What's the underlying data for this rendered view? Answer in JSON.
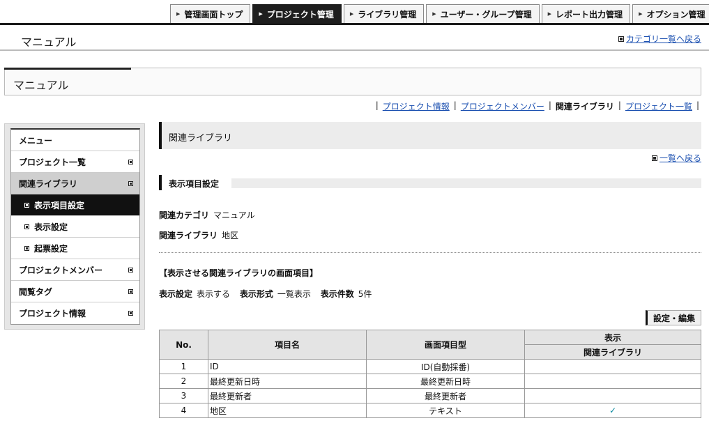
{
  "top_nav": {
    "tabs": [
      {
        "label": "管理画面トップ"
      },
      {
        "label": "プロジェクト管理",
        "active": true
      },
      {
        "label": "ライブラリ管理"
      },
      {
        "label": "ユーザー・グループ管理"
      },
      {
        "label": "レポート出力管理"
      },
      {
        "label": "オプション管理"
      }
    ]
  },
  "header": {
    "title": "マニュアル",
    "back_to_category": "カテゴリ一覧へ戻る"
  },
  "section": {
    "title": "マニュアル"
  },
  "sub_links": {
    "project_info": "プロジェクト情報",
    "project_members": "プロジェクトメンバー",
    "related_library": "関連ライブラリ",
    "project_list": "プロジェクト一覧"
  },
  "sidebar": {
    "menu_title": "メニュー",
    "items": {
      "project_list": "プロジェクト一覧",
      "related_library": "関連ライブラリ",
      "display_item_settings": "表示項目設定",
      "display_settings": "表示設定",
      "ticket_settings": "起票設定",
      "project_members": "プロジェクトメンバー",
      "view_tags": "閲覧タグ",
      "project_info": "プロジェクト情報"
    }
  },
  "main": {
    "title": "関連ライブラリ",
    "back_to_list": "一覧へ戻る",
    "subhead": "表示項目設定",
    "related_category_label": "関連カテゴリ",
    "related_category_value": "マニュアル",
    "related_library_label": "関連ライブラリ",
    "related_library_value": "地区",
    "screen_items_heading": "【表示させる関連ライブラリの画面項目】",
    "display_setting_label": "表示設定",
    "display_setting_value": "表示する",
    "display_format_label": "表示形式",
    "display_format_value": "一覧表示",
    "display_count_label": "表示件数",
    "display_count_value": "5件",
    "edit_button": "設定・編集"
  },
  "table": {
    "headers": {
      "no": "No.",
      "item_name": "項目名",
      "screen_type": "画面項目型",
      "display": "表示",
      "related_library": "関連ライブラリ"
    },
    "rows": [
      {
        "no": "1",
        "name": "ID",
        "type": "ID(自動採番)",
        "check": ""
      },
      {
        "no": "2",
        "name": "最終更新日時",
        "type": "最終更新日時",
        "check": ""
      },
      {
        "no": "3",
        "name": "最終更新者",
        "type": "最終更新者",
        "check": ""
      },
      {
        "no": "4",
        "name": "地区",
        "type": "テキスト",
        "check": "✓"
      }
    ]
  }
}
